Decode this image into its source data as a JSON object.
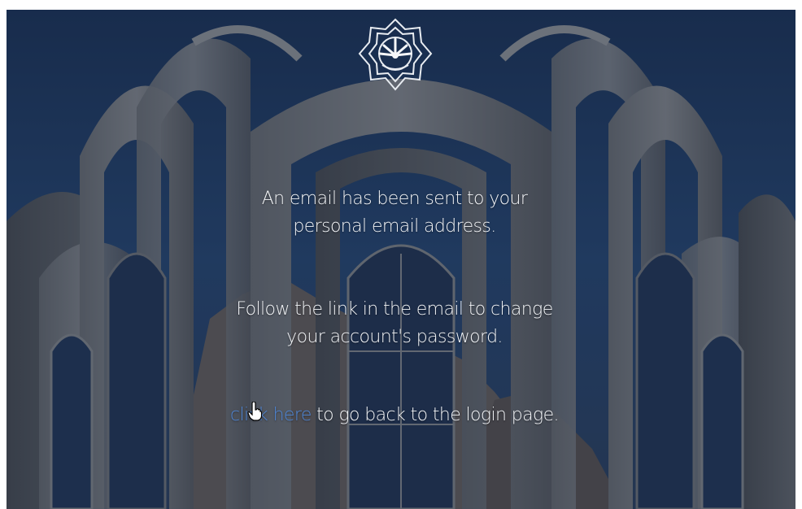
{
  "message": {
    "line1": "An email has been sent to your",
    "line2": "personal email address.",
    "line3": "Follow the link in the email to change",
    "line4": "your account's password.",
    "link_text": "click here",
    "after_link": " to go back to the login page."
  },
  "logo": {
    "icon": "university-emblem-icon"
  },
  "colors": {
    "link": "#4f86d6",
    "text": "#f2f4f7",
    "sky": "#1d3557"
  },
  "cursor": {
    "icon": "hand-pointer-icon"
  }
}
